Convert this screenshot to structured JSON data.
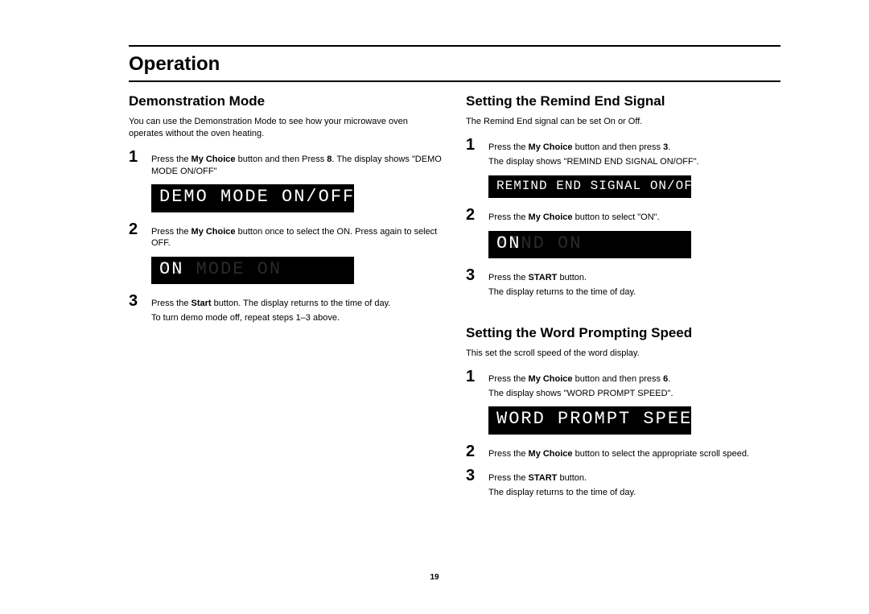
{
  "header": {
    "title": "Operation"
  },
  "left": {
    "title": "Demonstration Mode",
    "intro": "You can use the Demonstration Mode to see how your microwave oven operates without the oven heating.",
    "steps": [
      {
        "num": "1",
        "parts": [
          "Press the ",
          "My Choice",
          " button and then Press ",
          "8",
          ". The display shows \"DEMO MODE ON/OFF\""
        ],
        "display": {
          "size": "large",
          "text": "DEMO MODE ON/OFF"
        }
      },
      {
        "num": "2",
        "parts": [
          "Press the ",
          "My Choice",
          " button once to select the ON. Press again to select OFF."
        ],
        "display": {
          "size": "large",
          "text": "ON",
          "ghost": "  MO MODE ON"
        }
      },
      {
        "num": "3",
        "lines": [
          [
            "Press the ",
            "Start",
            " button. The display returns to the time of day."
          ],
          [
            "To turn demo mode off, repeat steps 1–3 above."
          ]
        ]
      }
    ]
  },
  "right": {
    "sections": [
      {
        "title": "Setting the Remind End Signal",
        "intro": "The Remind End signal can be set On or Off.",
        "steps": [
          {
            "num": "1",
            "lines": [
              [
                "Press the ",
                "My Choice",
                " button and then press ",
                "3",
                "."
              ],
              [
                "The display shows \"REMIND END SIGNAL ON/OFF\"."
              ]
            ],
            "display": {
              "size": "small",
              "text": "REMIND END SIGNAL ON/OFF"
            }
          },
          {
            "num": "2",
            "parts": [
              "Press the ",
              "My Choice",
              " button to select  \"ON\"."
            ],
            "display": {
              "size": "large",
              "text": "ON",
              "ghost": "  MIND ON"
            }
          },
          {
            "num": "3",
            "lines": [
              [
                "Press the ",
                "START",
                " button."
              ],
              [
                "The display returns to the time of day."
              ]
            ]
          }
        ]
      },
      {
        "title": "Setting the Word Prompting Speed",
        "intro": "This set the scroll speed of the word display.",
        "steps": [
          {
            "num": "1",
            "lines": [
              [
                "Press the ",
                "My Choice",
                " button and then press ",
                "6",
                "."
              ],
              [
                "The display shows \"WORD PROMPT SPEED\"."
              ]
            ],
            "display": {
              "size": "large",
              "text": "WORD PROMPT SPEED"
            }
          },
          {
            "num": "2",
            "parts": [
              "Press the ",
              "My Choice",
              " button to select the appropriate scroll speed."
            ]
          },
          {
            "num": "3",
            "lines": [
              [
                "Press the ",
                "START",
                " button."
              ],
              [
                "The display returns to the time of day."
              ]
            ]
          }
        ]
      }
    ]
  },
  "pageNumber": "19"
}
